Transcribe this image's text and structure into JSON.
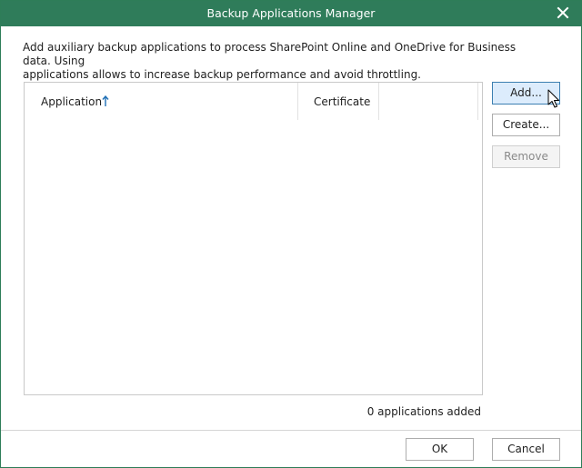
{
  "window": {
    "title": "Backup Applications Manager",
    "close_icon": "close-icon",
    "accent_color": "#2f7c5a"
  },
  "description": {
    "line1": "Add auxiliary backup applications to process SharePoint Online and OneDrive for Business data. Using",
    "line2": "applications allows to increase backup performance and avoid throttling."
  },
  "grid": {
    "columns": [
      {
        "label": "Application",
        "sort": "ascending",
        "sort_icon": "sort-up-arrow-icon"
      },
      {
        "label": "Certificate"
      },
      {
        "label": ""
      }
    ],
    "rows": []
  },
  "side_buttons": {
    "add": "Add...",
    "create": "Create...",
    "remove": "Remove"
  },
  "status": "0 applications added",
  "footer": {
    "ok": "OK",
    "cancel": "Cancel"
  }
}
